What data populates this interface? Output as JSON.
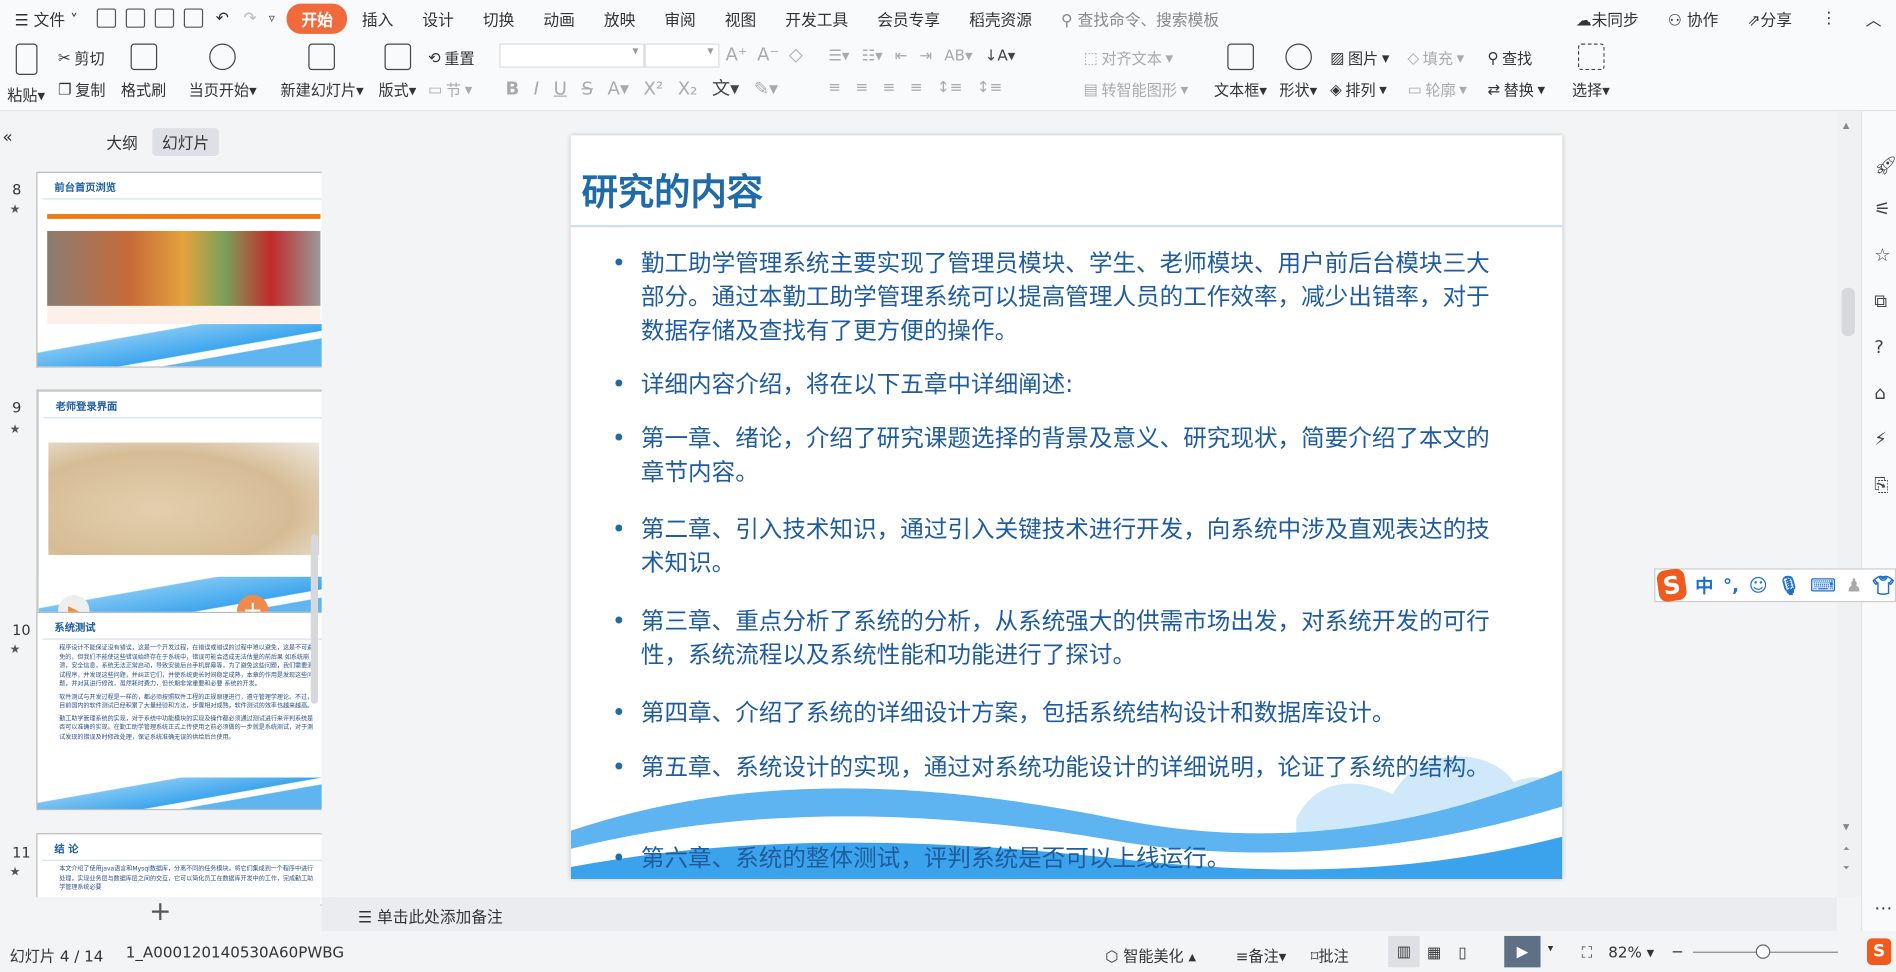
{
  "menubar": {
    "file": "文件",
    "tabs": [
      "开始",
      "插入",
      "设计",
      "切换",
      "动画",
      "放映",
      "审阅",
      "视图",
      "开发工具",
      "会员专享",
      "稻壳资源"
    ],
    "search": "查找命令、搜索模板",
    "sync": "未同步",
    "collab": "协作",
    "share": "分享"
  },
  "ribbon": {
    "paste": "粘贴",
    "cut": "剪切",
    "copy": "复制",
    "format_painter": "格式刷",
    "play_from_current": "当页开始",
    "new_slide": "新建幻灯片",
    "layout": "版式",
    "section": "节",
    "reset": "重置",
    "align_text": "对齐文本",
    "smart_art": "转智能图形",
    "textbox": "文本框",
    "shape": "形状",
    "picture": "图片",
    "fill": "填充",
    "arrange": "排列",
    "outline": "轮廓",
    "find": "查找",
    "replace": "替换",
    "select": "选择"
  },
  "panel": {
    "tab_outline": "大纲",
    "tab_slides": "幻灯片",
    "add": "+"
  },
  "thumbnails": [
    {
      "num": "8",
      "title": "前台首页浏览"
    },
    {
      "num": "9",
      "title": "老师登录界面"
    },
    {
      "num": "10",
      "title": "系统测试",
      "bullets": [
        "程序设计不能保证没有错误，这是一个开发过程，在错误或错误的过程中难以避免，这是不可避免的，但我们不能使这些错误始终存在于系统中，错误可能会造成无法估量的前后果 如系统崩溃，安全信息，系统无法正常启动，导致安装后台手机屏幕等，为了避免这些问题，我们需要测试程序，并发现这些问题，并纠正它们，并使系统更长时间稳定成熟，本章的作用是发现这些问题，并对其进行修改，虽然耗时费力，但长期非常重要和必要 系统的开发。",
        "软件测试与开发过程是一样的，都必须按照软件工程的正规原理进行，遵守管理学理论。不过，目前国内的软件测试已经积累了大量经验和方法，步骤相对成熟，软件测试的效率也越来越高。",
        "勤工助学管理系统的实现，对于系统中功能模块的实现及操作都必须通过测试进行来评判系统是否可以准确的实现。在勤工助学管理系统正式上传使用之前必须做的一步就是系统测试，对于测试发现的错误及时修改处理，保证系统准确无误的供给后台使用。"
      ]
    },
    {
      "num": "11",
      "title": "结 论",
      "bullets": [
        "本文介绍了使用java语言和Mysql数据库，分离不同的任务模块，将它们集成到一个程序中进行处理，实现业务层与数据库层之间的交互，它可以简化员工在数据库开发中的工作，完成勤工助学管理系统必要"
      ]
    }
  ],
  "slide": {
    "title": "研究的内容",
    "bullets": [
      "勤工助学管理系统主要实现了管理员模块、学生、老师模块、用户前后台模块三大部分。通过本勤工助学管理系统可以提高管理人员的工作效率，减少出错率，对于数据存储及查找有了更方便的操作。",
      "详细内容介绍，将在以下五章中详细阐述:",
      "第一章、绪论，介绍了研究课题选择的背景及意义、研究现状，简要介绍了本文的章节内容。",
      "第二章、引入技术知识，通过引入关键技术进行开发，向系统中涉及直观表达的技术知识。",
      "第三章、重点分析了系统的分析，从系统强大的供需市场出发，对系统开发的可行性，系统流程以及系统性能和功能进行了探讨。",
      "第四章、介绍了系统的详细设计方案，包括系统结构设计和数据库设计。",
      "第五章、系统设计的实现，通过对系统功能设计的详细说明，论证了系统的结构。",
      "第六章、系统的整体测试，评判系统是否可以上线运行。"
    ]
  },
  "notes": {
    "placeholder": "单击此处添加备注"
  },
  "status": {
    "slide_info": "幻灯片 4 / 14",
    "theme": "1_A000120140530A60PWBG",
    "beautify": "智能美化",
    "notes": "备注",
    "comment": "批注",
    "zoom": "82%"
  },
  "ime": {
    "mode": "中",
    "punct": "°,"
  }
}
